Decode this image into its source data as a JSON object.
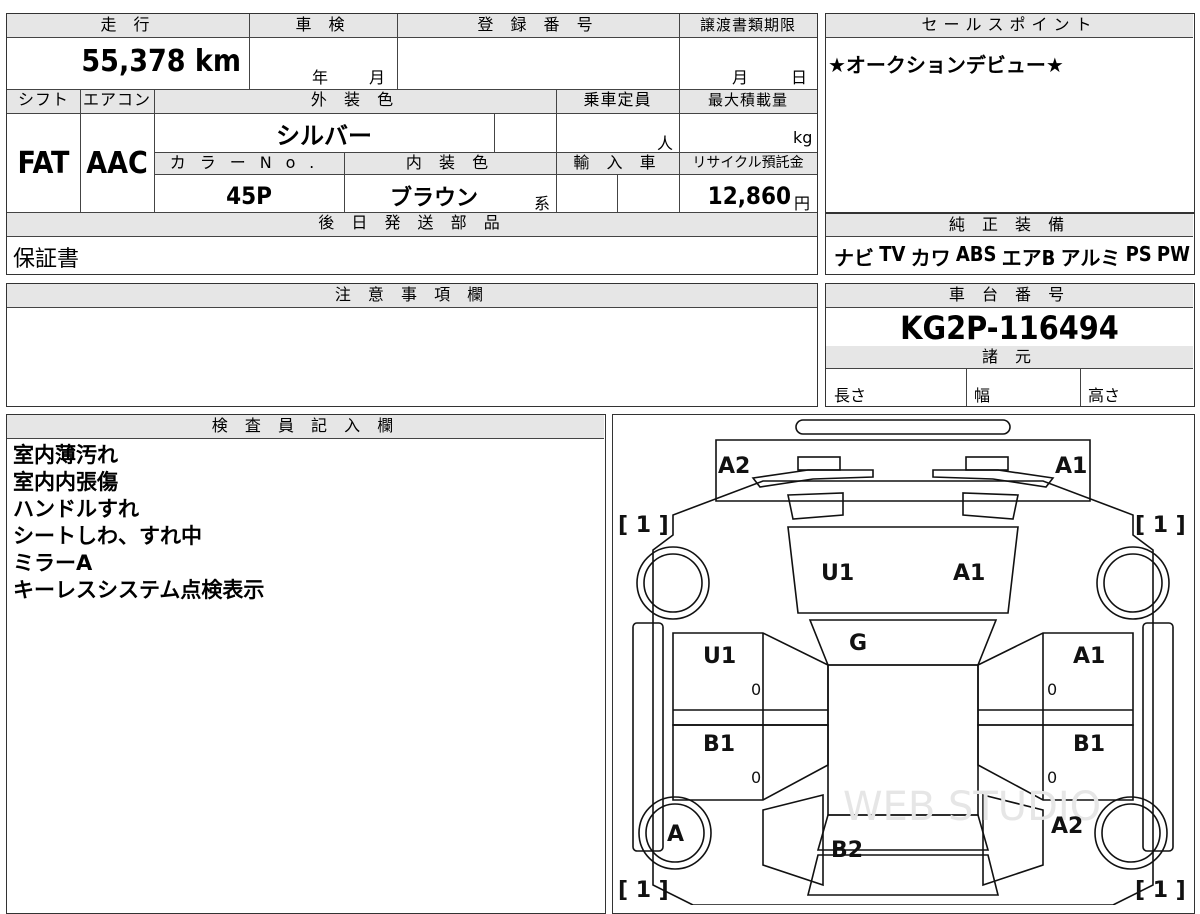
{
  "top_left": {
    "mileage_header": "走 行",
    "mileage_value": "55,378 km",
    "inspection_header": "車 検",
    "inspection_year_unit": "年",
    "inspection_month_unit": "月",
    "registration_header": "登 録 番 号",
    "transfer_header": "譲渡書類期限",
    "transfer_month_unit": "月",
    "transfer_day_unit": "日",
    "shift_header": "シフト",
    "aircon_header": "エアコン",
    "exterior_color_header": "外 装 色",
    "capacity_header": "乗車定員",
    "max_load_header": "最大積載量",
    "shift_value": "FAT",
    "aircon_value": "AAC",
    "exterior_color_value": "シルバー",
    "capacity_unit": "人",
    "max_load_unit": "kg",
    "color_no_header": "カラーNo.",
    "interior_color_header": "内 装 色",
    "import_header": "輸 入 車",
    "recycle_header": "リサイクル預託金",
    "color_no_value": "45P",
    "interior_color_value": "ブラウン",
    "interior_color_suffix": "系",
    "recycle_value": "12,860",
    "recycle_unit": "円",
    "later_parts_header": "後 日 発 送 部 品",
    "later_parts_value": "保証書"
  },
  "sales_point": {
    "header": "セールスポイント",
    "value": "★オークションデビュー★"
  },
  "equipment": {
    "header": "純 正 装 備",
    "items": [
      "ナビ",
      "TV",
      "カワ",
      "ABS",
      "エアB",
      "アルミ",
      "PS",
      "PW"
    ]
  },
  "notes": {
    "header": "注 意 事 項 欄"
  },
  "chassis": {
    "header": "車 台 番 号",
    "value": "KG2P-116494",
    "specs_header": "諸 元",
    "length_label": "長さ",
    "width_label": "幅",
    "height_label": "高さ"
  },
  "inspector": {
    "header": "検 査 員 記 入 欄",
    "lines": [
      "室内薄汚れ",
      "室内内張傷",
      "ハンドルすれ",
      "シートしわ、すれ中",
      "ミラーA",
      "キーレスシステム点検表示"
    ]
  },
  "diagram": {
    "watermark": "WEB STUDIO",
    "tire_bracket": "[ 1 ]",
    "marks": {
      "front_left_corner": "A2",
      "front_right_corner": "A1",
      "windshield_left": "U1",
      "windshield_right": "A1",
      "roof": "G",
      "left_front_door": "U1",
      "right_front_door": "A1",
      "left_rear_door": "B1",
      "right_rear_door": "B1",
      "rear_left_wheel": "A",
      "rear_right_quarter": "A2",
      "rear_center": "B2",
      "door_zero": "0"
    }
  }
}
